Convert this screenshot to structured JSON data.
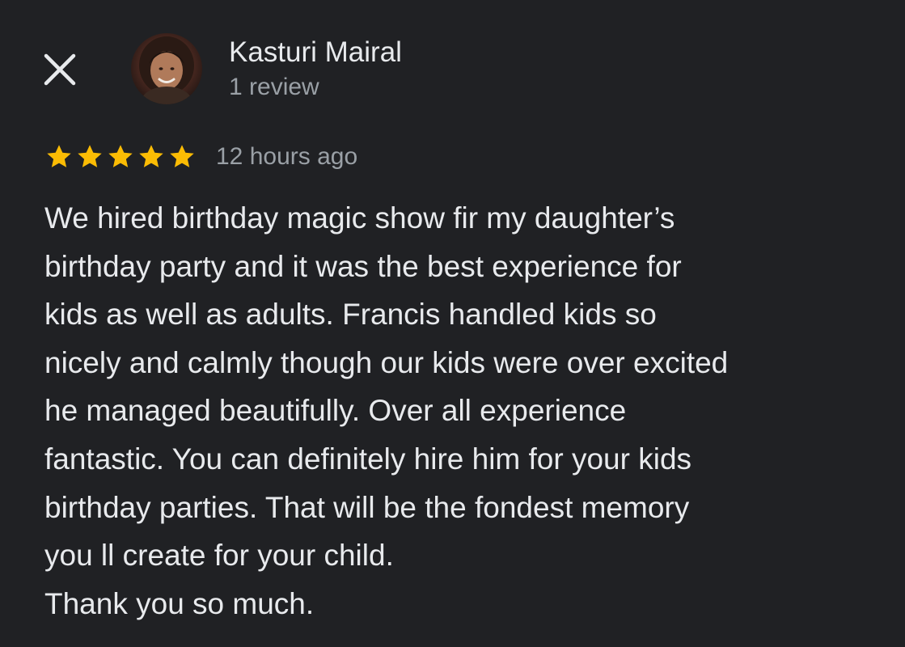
{
  "header": {
    "close_icon": "close-icon",
    "reviewer": {
      "name": "Kasturi Mairal",
      "review_count": "1 review",
      "avatar": "avatar-photo"
    }
  },
  "review": {
    "rating": 5,
    "rating_max": 5,
    "star_color": "#fbbc04",
    "timestamp": "12 hours ago",
    "lines": [
      "We hired birthday magic show fir my daughter’s",
      "birthday party and it was the best experience for",
      "kids as well as adults. Francis handled kids so",
      "nicely and calmly though our kids were over excited",
      "he managed beautifully. Over all experience",
      "fantastic. You can definitely hire him for your kids",
      "birthday parties. That will be the fondest memory",
      "you ll create for your child.",
      "Thank you so much."
    ]
  },
  "colors": {
    "background": "#202124",
    "primary_text": "#e8eaed",
    "secondary_text": "#9aa0a6"
  }
}
